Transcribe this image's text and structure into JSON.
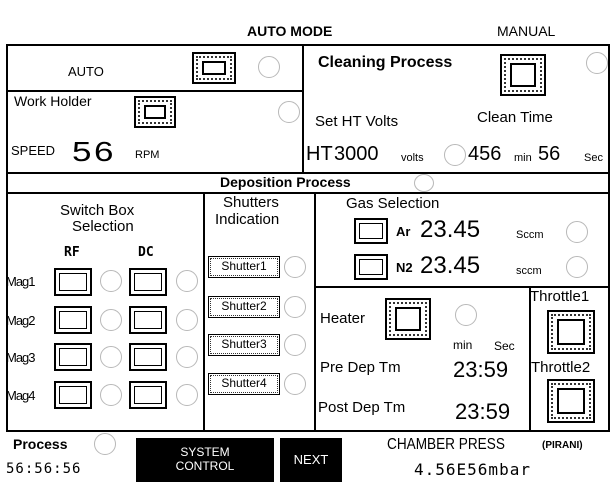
{
  "header": {
    "title": "AUTO MODE",
    "manual_label": "MANUAL"
  },
  "auto_panel": {
    "auto_label": "AUTO",
    "work_holder_label": "Work Holder",
    "speed_label": "SPEED",
    "speed_value": "56",
    "speed_unit": "RPM"
  },
  "cleaning": {
    "title": "Cleaning Process",
    "set_ht_label": "Set HT Volts",
    "clean_time_label": "Clean Time",
    "ht_prefix": "HT",
    "ht_value": "3000",
    "ht_unit": "volts",
    "clean_min": "456",
    "min_unit": "min",
    "clean_sec": "56",
    "sec_unit": "Sec"
  },
  "deposition": {
    "title": "Deposition Process"
  },
  "switch_box": {
    "title_line1": "Switch Box",
    "title_line2": "Selection",
    "rf_label": "RF",
    "dc_label": "DC",
    "mags": [
      "Mag1",
      "Mag2",
      "Mag3",
      "Mag4"
    ]
  },
  "shutters": {
    "title_line1": "Shutters",
    "title_line2": "Indication",
    "items": [
      "Shutter1",
      "Shutter2",
      "Shutter3",
      "Shutter4"
    ]
  },
  "gas": {
    "title": "Gas Selection",
    "rows": [
      {
        "name": "Ar",
        "value": "23.45",
        "unit": "Sccm"
      },
      {
        "name": "N2",
        "value": "23.45",
        "unit": "sccm"
      }
    ]
  },
  "heater": {
    "label": "Heater",
    "min_label": "min",
    "sec_label": "Sec",
    "pre_dep_label": "Pre Dep Tm",
    "pre_dep_value": "23:59",
    "post_dep_label": "Post Dep Tm",
    "post_dep_value": "23:59"
  },
  "throttle": {
    "t1": "Throttle1",
    "t2": "Throttle2"
  },
  "footer": {
    "process_label": "Process",
    "process_time": "56:56:56",
    "system_control_line1": "SYSTEM",
    "system_control_line2": "CONTROL",
    "next_label": "NEXT",
    "chamber_label": "CHAMBER PRESS",
    "pirani_label": "(PIRANI)",
    "chamber_value": "4.56E56mbar"
  }
}
